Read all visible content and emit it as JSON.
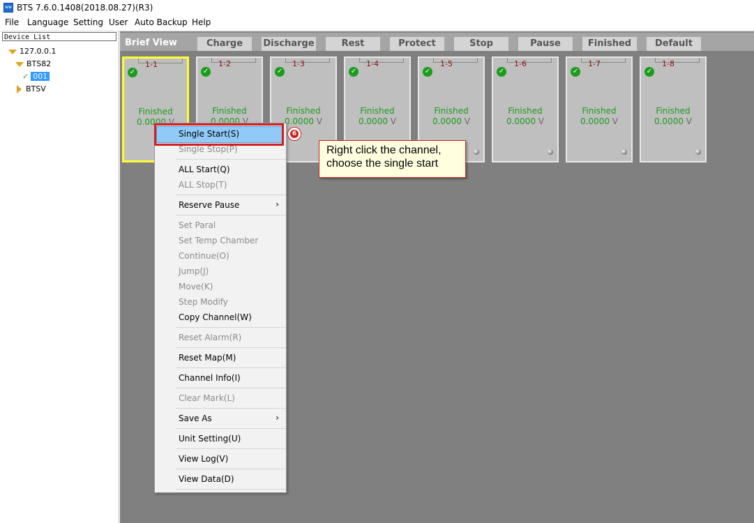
{
  "window": {
    "title": "BTS 7.6.0.1408(2018.08.27)(R3)",
    "icon_text": "ᴡᴡ"
  },
  "menu": [
    "File",
    "Language",
    "Setting",
    "User",
    "Auto Backup",
    "Help"
  ],
  "device_list": {
    "header": "Device List",
    "nodes": [
      {
        "label": "127.0.0.1"
      },
      {
        "label": "BTS82"
      },
      {
        "label": "001"
      },
      {
        "label": "BTSV"
      }
    ]
  },
  "tabs": {
    "brief": "Brief View",
    "items": [
      "Charge",
      "Discharge",
      "Rest",
      "Protect",
      "Stop",
      "Pause",
      "Finished",
      "Default"
    ]
  },
  "channels": [
    {
      "label": "1-1",
      "status": "Finished",
      "voltage": "0.0000",
      "unit": "V"
    },
    {
      "label": "1-2",
      "status": "Finished",
      "voltage": "0.0000",
      "unit": "V"
    },
    {
      "label": "1-3",
      "status": "Finished",
      "voltage": "0.0000",
      "unit": "V"
    },
    {
      "label": "1-4",
      "status": "Finished",
      "voltage": "0.0000",
      "unit": "V"
    },
    {
      "label": "1-5",
      "status": "Finished",
      "voltage": "0.0000",
      "unit": "V"
    },
    {
      "label": "1-6",
      "status": "Finished",
      "voltage": "0.0000",
      "unit": "V"
    },
    {
      "label": "1-7",
      "status": "Finished",
      "voltage": "0.0000",
      "unit": "V"
    },
    {
      "label": "1-8",
      "status": "Finished",
      "voltage": "0.0000",
      "unit": "V"
    }
  ],
  "context_menu": {
    "items": [
      {
        "label": "Single Start(S)"
      },
      {
        "label": "Single Stop(P)"
      },
      {
        "label": "ALL Start(Q)"
      },
      {
        "label": "ALL Stop(T)"
      },
      {
        "label": "Reserve Pause",
        "arrow": "›"
      },
      {
        "label": "Set Paral"
      },
      {
        "label": "Set Temp Chamber"
      },
      {
        "label": "Continue(O)"
      },
      {
        "label": "Jump(J)"
      },
      {
        "label": "Move(K)"
      },
      {
        "label": "Step Modify"
      },
      {
        "label": "Copy Channel(W)"
      },
      {
        "label": "Reset Alarm(R)"
      },
      {
        "label": "Reset Map(M)"
      },
      {
        "label": "Channel Info(I)"
      },
      {
        "label": "Clear Mark(L)"
      },
      {
        "label": "Save As",
        "arrow": "›"
      },
      {
        "label": "Unit Setting(U)"
      },
      {
        "label": "View Log(V)"
      },
      {
        "label": "View Data(D)"
      }
    ]
  },
  "annotation": {
    "step": "6",
    "text": "Right click the channel, choose the single start"
  },
  "colors": {
    "highlight": "#91c9f7",
    "annotation_red": "#d41e1e",
    "status_green": "#1e9a1e",
    "selected_border": "#ffff33"
  }
}
